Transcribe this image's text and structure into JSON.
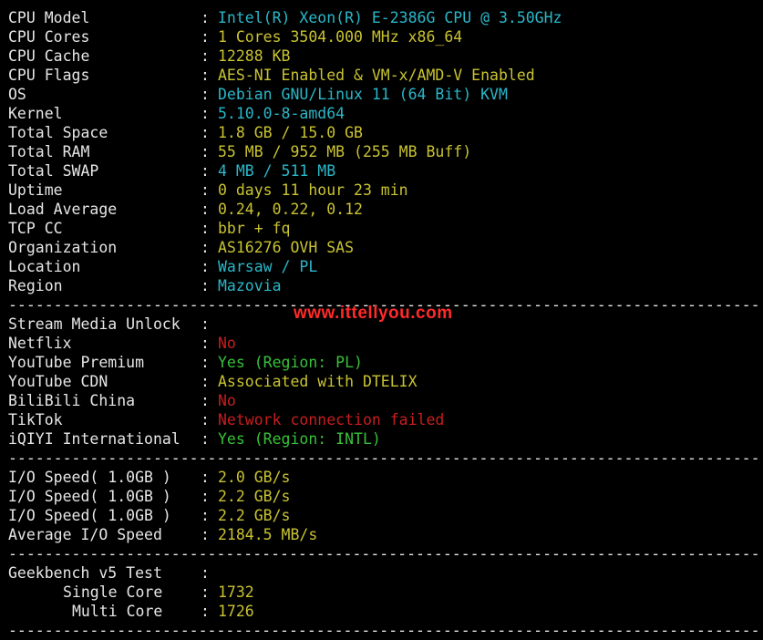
{
  "colors": {
    "background": "#000000",
    "label": "#e6e6e6",
    "cyan": "#2ab7c9",
    "yellow": "#c9c331",
    "green": "#38c138",
    "red": "#c81e1e",
    "watermark": "#ff2a2a"
  },
  "separator": "------------------------------------------------------------------------------------------------",
  "watermark": "www.ittellyou.com",
  "system": [
    {
      "label": "CPU Model",
      "value": "Intel(R) Xeon(R) E-2386G CPU @ 3.50GHz",
      "color": "cyan"
    },
    {
      "label": "CPU Cores",
      "value": "1 Cores 3504.000 MHz x86_64",
      "color": "yellow"
    },
    {
      "label": "CPU Cache",
      "value": "12288 KB",
      "color": "yellow"
    },
    {
      "label": "CPU Flags",
      "value": "AES-NI Enabled & VM-x/AMD-V Enabled",
      "color": "yellow"
    },
    {
      "label": "OS",
      "value": "Debian GNU/Linux 11 (64 Bit) KVM",
      "color": "cyan"
    },
    {
      "label": "Kernel",
      "value": "5.10.0-8-amd64",
      "color": "cyan"
    },
    {
      "label": "Total Space",
      "value": "1.8 GB / 15.0 GB",
      "color": "yellow"
    },
    {
      "label": "Total RAM",
      "value": "55 MB / 952 MB (255 MB Buff)",
      "color": "yellow"
    },
    {
      "label": "Total SWAP",
      "value": "4 MB / 511 MB",
      "color": "cyan"
    },
    {
      "label": "Uptime",
      "value": "0 days 11 hour 23 min",
      "color": "yellow"
    },
    {
      "label": "Load Average",
      "value": "0.24, 0.22, 0.12",
      "color": "yellow"
    },
    {
      "label": "TCP CC",
      "value": "bbr + fq",
      "color": "yellow"
    },
    {
      "label": "Organization",
      "value": "AS16276 OVH SAS",
      "color": "yellow"
    },
    {
      "label": "Location",
      "value": "Warsaw / PL",
      "color": "cyan"
    },
    {
      "label": "Region",
      "value": "Mazovia",
      "color": "cyan"
    }
  ],
  "media": [
    {
      "label": "Stream Media Unlock",
      "value": "",
      "color": "cyan"
    },
    {
      "label": "Netflix",
      "value": "No",
      "color": "red"
    },
    {
      "label": "YouTube Premium",
      "value": "Yes (Region: PL)",
      "color": "green"
    },
    {
      "label": "YouTube CDN",
      "value": "Associated with DTELIX",
      "color": "yellow"
    },
    {
      "label": "BiliBili China",
      "value": "No",
      "color": "red"
    },
    {
      "label": "TikTok",
      "value": "Network connection failed",
      "color": "red"
    },
    {
      "label": "iQIYI International",
      "value": "Yes (Region: INTL)",
      "color": "green"
    }
  ],
  "io": [
    {
      "label": "I/O Speed( 1.0GB )",
      "value": "2.0 GB/s",
      "color": "yellow"
    },
    {
      "label": "I/O Speed( 1.0GB )",
      "value": "2.2 GB/s",
      "color": "yellow"
    },
    {
      "label": "I/O Speed( 1.0GB )",
      "value": "2.2 GB/s",
      "color": "yellow"
    },
    {
      "label": "Average I/O Speed",
      "value": "2184.5 MB/s",
      "color": "yellow"
    }
  ],
  "geekbench": [
    {
      "label": "Geekbench v5 Test",
      "value": "",
      "color": "yellow",
      "indent": 0
    },
    {
      "label": "Single Core",
      "value": "1732",
      "color": "yellow",
      "indent": 1
    },
    {
      "label": "Multi Core",
      "value": "1726",
      "color": "yellow",
      "indent": 2
    }
  ]
}
